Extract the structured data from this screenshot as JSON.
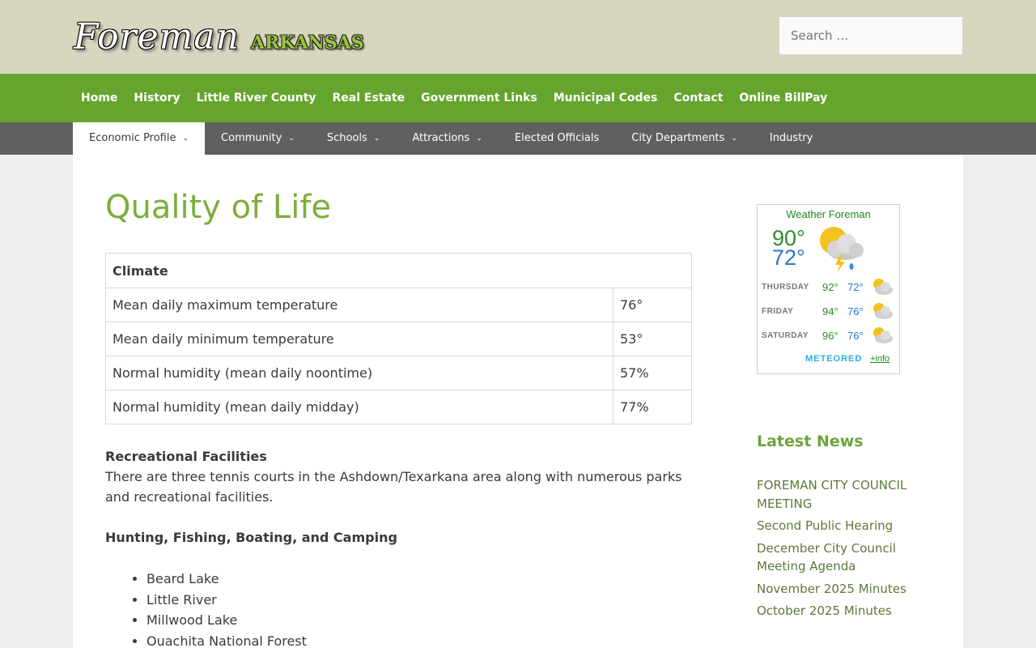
{
  "header": {
    "logo_script": "Foreman",
    "logo_state": "ARKANSAS",
    "search_placeholder": "Search …"
  },
  "primary_nav": [
    "Home",
    "History",
    "Little River County",
    "Real Estate",
    "Government Links",
    "Municipal Codes",
    "Contact",
    "Online BillPay"
  ],
  "secondary_nav": [
    {
      "label": "Economic Profile",
      "dropdown": true,
      "active": true
    },
    {
      "label": "Community",
      "dropdown": true
    },
    {
      "label": "Schools",
      "dropdown": true
    },
    {
      "label": "Attractions",
      "dropdown": true
    },
    {
      "label": "Elected Officials",
      "dropdown": false
    },
    {
      "label": "City Departments",
      "dropdown": true
    },
    {
      "label": "Industry",
      "dropdown": false
    }
  ],
  "main": {
    "title": "Quality of Life",
    "climate_table": {
      "heading": "Climate",
      "rows": [
        {
          "label": "Mean daily maximum temperature",
          "value": "76°"
        },
        {
          "label": "Mean daily minimum temperature",
          "value": "53°"
        },
        {
          "label": "Normal humidity (mean daily noontime)",
          "value": "57%"
        },
        {
          "label": "Normal humidity (mean daily midday)",
          "value": "77%"
        }
      ]
    },
    "recreation_heading": "Recreational Facilities",
    "recreation_text": "There are three tennis courts in the Ashdown/Texarkana area along with numerous parks and recreational facilities.",
    "outdoors_heading": "Hunting, Fishing, Boating, and Camping",
    "outdoors_list": [
      "Beard Lake",
      "Little River",
      "Millwood Lake",
      "Ouachita National Forest"
    ]
  },
  "sidebar": {
    "weather": {
      "title": "Weather Foreman",
      "today_hi": "90°",
      "today_lo": "72°",
      "forecast": [
        {
          "day": "THURSDAY",
          "hi": "92°",
          "lo": "72°"
        },
        {
          "day": "FRIDAY",
          "hi": "94°",
          "lo": "76°"
        },
        {
          "day": "SATURDAY",
          "hi": "96°",
          "lo": "76°"
        }
      ],
      "brand": "METEORED",
      "info_link": "+info"
    },
    "latest_news_title": "Latest News",
    "news": [
      "FOREMAN CITY COUNCIL MEETING",
      "Second Public Hearing",
      "December City Council Meeting Agenda",
      "November 2025 Minutes",
      "October 2025 Minutes"
    ]
  },
  "colors": {
    "header_bg": "#d9d6c0",
    "primary_nav_bg": "#65a52e",
    "secondary_nav_bg": "#606060",
    "title_green": "#7dae3d",
    "link_green": "#5a7a3a"
  }
}
